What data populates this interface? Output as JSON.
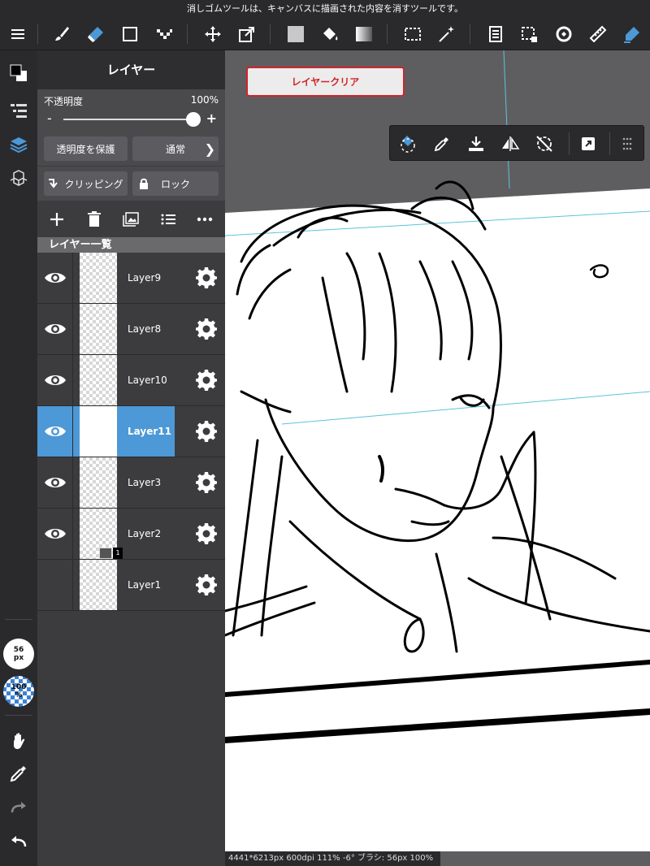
{
  "tooltip": "消しゴムツールは、キャンバスに描画された内容を消すツールです。",
  "toolbar": {
    "tools": [
      "menu-icon",
      "brush-icon",
      "eraser-icon",
      "rectangle-icon",
      "dot-icon",
      "move-icon",
      "transform-icon",
      "fill-color-icon",
      "bucket-icon",
      "gradient-icon",
      "select-rect-icon",
      "magic-wand-icon",
      "layer-properties-icon",
      "selection-icon",
      "rotate-icon",
      "ruler-icon",
      "pen-icon"
    ],
    "accent": "#4d98d6"
  },
  "panel": {
    "title": "レイヤー",
    "opacity_label": "不透明度",
    "opacity_value": "100%",
    "opacity_fraction": 1.0,
    "minus": "-",
    "plus": "+",
    "protect_alpha": "透明度を保護",
    "blend_mode": "通常",
    "clipping": "クリッピング",
    "lock": "ロック",
    "list_header": "レイヤー一覧",
    "layers": [
      {
        "name": "Layer9",
        "visible": true,
        "selected": false
      },
      {
        "name": "Layer8",
        "visible": true,
        "selected": false
      },
      {
        "name": "Layer10",
        "visible": true,
        "selected": false
      },
      {
        "name": "Layer11",
        "visible": true,
        "selected": true
      },
      {
        "name": "Layer3",
        "visible": true,
        "selected": false
      },
      {
        "name": "Layer2",
        "visible": true,
        "selected": false
      },
      {
        "name": "Layer1",
        "visible": false,
        "selected": false
      }
    ],
    "badge": "1"
  },
  "rail": {
    "brush_size": "56\npx",
    "brush_opacity": "100\n%"
  },
  "canvas": {
    "clear_button": "レイヤークリア"
  },
  "bottom_status": "4441*6213px 600dpi 111% -6° ブラシ: 56px 100%"
}
